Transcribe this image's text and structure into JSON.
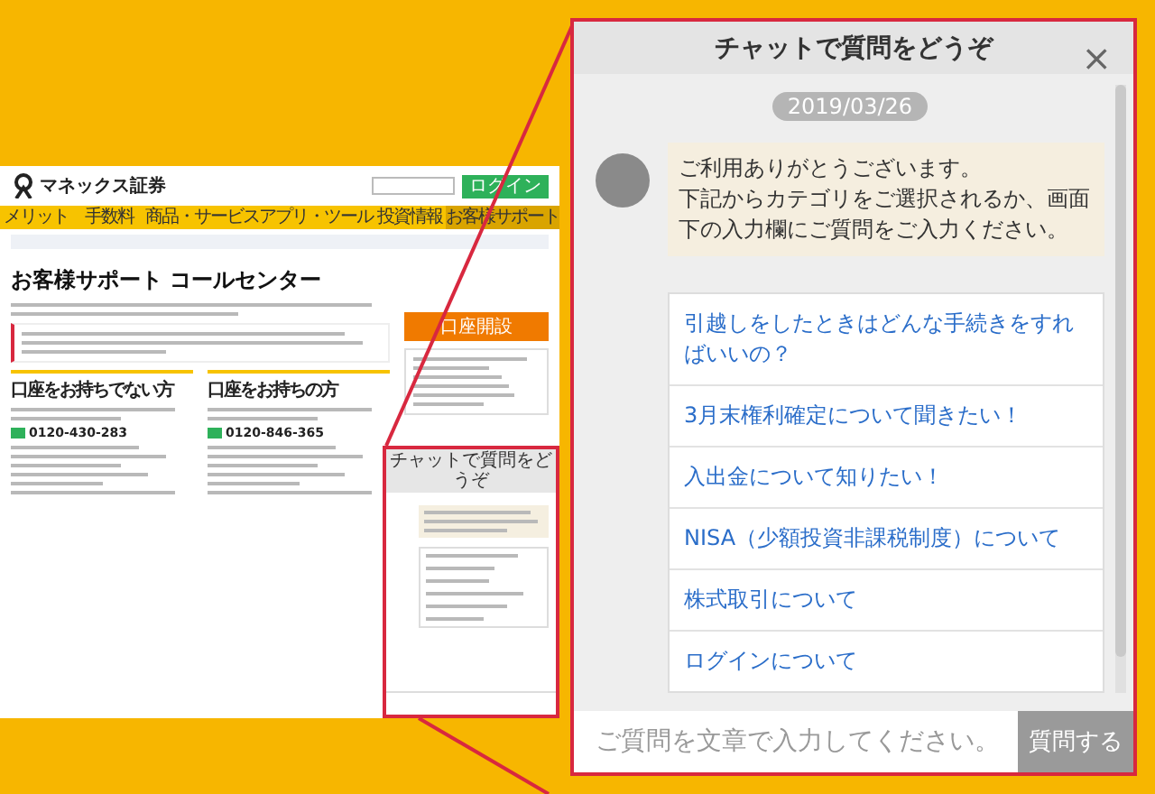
{
  "page": {
    "brand": "マネックス証券",
    "login": "ログイン",
    "nav": [
      {
        "label": "メリット",
        "selected": false
      },
      {
        "label": "手数料",
        "selected": false
      },
      {
        "label": "商品・サービス",
        "selected": false
      },
      {
        "label": "アプリ・ツール",
        "selected": false
      },
      {
        "label": "投資情報",
        "selected": false
      },
      {
        "label": "お客様サポート",
        "selected": true
      }
    ],
    "title": "お客様サポート コールセンター",
    "open_account": "口座開設",
    "sections": [
      {
        "heading": "口座をお持ちでない方",
        "phone": "0120-430-283"
      },
      {
        "heading": "口座をお持ちの方",
        "phone": "0120-846-365"
      }
    ],
    "mini_chat": {
      "title": "チャットで質問をどうぞ"
    }
  },
  "chat": {
    "title": "チャットで質問をどうぞ",
    "close": "×",
    "date": "2019/03/26",
    "message": [
      "ご利用ありがとうございます。",
      "下記からカテゴリをご選択されるか、画面下の入力欄にご質問をご入力ください。"
    ],
    "options": [
      "引越しをしたときはどんな手続きをすればいいの？",
      "3月末権利確定について聞きたい！",
      "入出金について知りたい！",
      "NISA（少額投資非課税制度）について",
      "株式取引について",
      "ログインについて"
    ],
    "input": {
      "placeholder": "ご質問を文章で入力してください。"
    },
    "submit": "質問する"
  }
}
